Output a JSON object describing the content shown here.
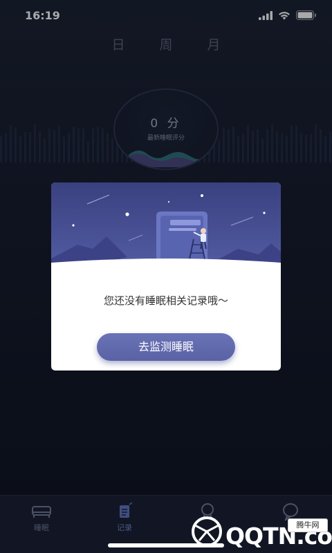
{
  "status_bar": {
    "time": "16:19",
    "icons": [
      "signal-icon",
      "wifi-icon",
      "battery-icon"
    ]
  },
  "period_tabs": [
    {
      "label": "日"
    },
    {
      "label": "周"
    },
    {
      "label": "月"
    }
  ],
  "score": {
    "value": "0 分",
    "label": "最新睡眠评分"
  },
  "modal": {
    "message": "您还没有睡眠相关记录哦～",
    "button_label": "去监测睡眠",
    "illustration": "person-on-ladder-illustration"
  },
  "bottom_nav": {
    "items": [
      {
        "label": "睡眠",
        "icon": "bed-icon"
      },
      {
        "label": "记录",
        "icon": "calendar-icon"
      },
      {
        "label": "",
        "icon": "medal-icon"
      },
      {
        "label": "",
        "icon": "chat-icon"
      }
    ]
  },
  "watermark": {
    "text": "QQTN.com",
    "badge": "腾牛网"
  },
  "colors": {
    "background": "#161b2b",
    "button": "#5a62a6",
    "modal_bg": "#ffffff"
  }
}
